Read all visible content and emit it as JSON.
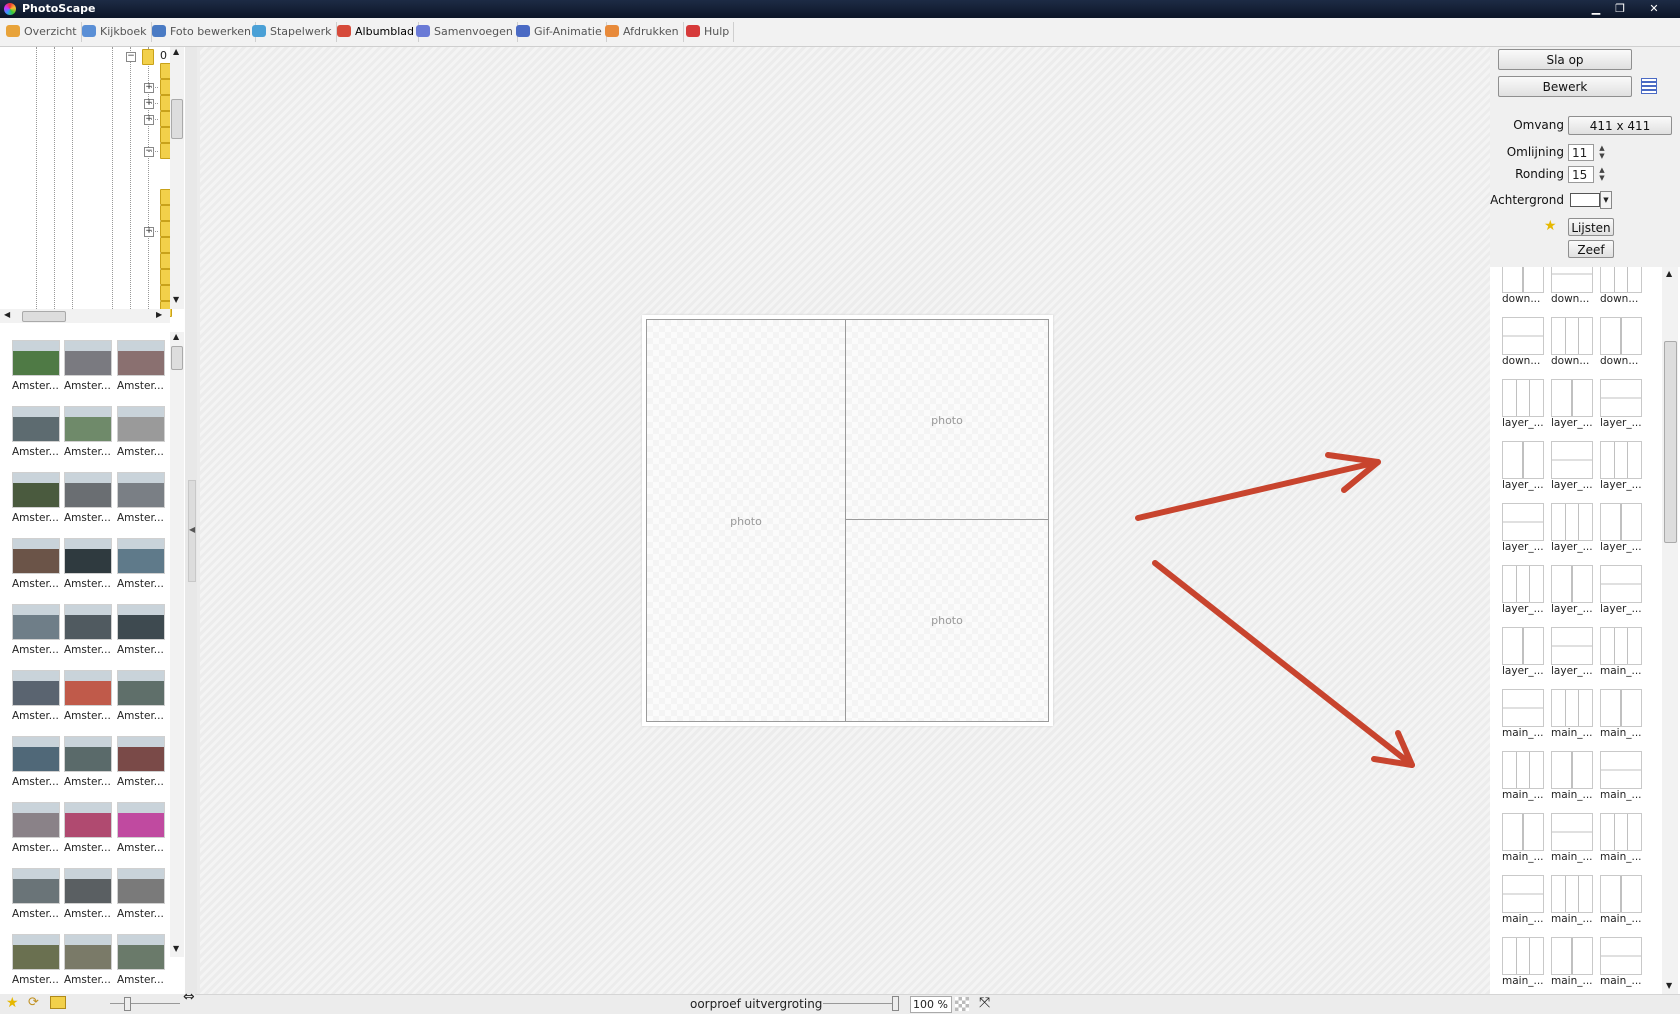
{
  "window": {
    "title": "PhotoScape",
    "controls": [
      "minimize",
      "restore",
      "close"
    ]
  },
  "tabs": [
    {
      "label": "Overzicht",
      "icon": "overview-icon",
      "color": "#e8a33a"
    },
    {
      "label": "Kijkboek",
      "icon": "viewer-icon",
      "color": "#5a8fd6"
    },
    {
      "label": "Foto bewerken",
      "icon": "editor-icon",
      "color": "#4a7bc4"
    },
    {
      "label": "Stapelwerk",
      "icon": "batch-icon",
      "color": "#4aa0d6"
    },
    {
      "label": "Albumblad",
      "icon": "page-icon",
      "color": "#d64a3a",
      "active": true
    },
    {
      "label": "Samenvoegen",
      "icon": "combine-icon",
      "color": "#6a7ad6"
    },
    {
      "label": "Gif-Animatie",
      "icon": "gif-icon",
      "color": "#4a6ac4"
    },
    {
      "label": "Afdrukken",
      "icon": "print-icon",
      "color": "#e88a3a"
    },
    {
      "label": "Hulp",
      "icon": "help-icon",
      "color": "#d63a3a"
    }
  ],
  "tree": {
    "root_label": "0"
  },
  "thumbnails": {
    "labels": [
      "Amster...",
      "Amster...",
      "Amster...",
      "Amster...",
      "Amster...",
      "Amster...",
      "Amster...",
      "Amster...",
      "Amster...",
      "Amster...",
      "Amster...",
      "Amster...",
      "Amster...",
      "Amster...",
      "Amster...",
      "Amster...",
      "Amster...",
      "Amster...",
      "Amster...",
      "Amster...",
      "Amster...",
      "Amster...",
      "Amster...",
      "Amster...",
      "Amster...",
      "Amster...",
      "Amster...",
      "Amster...",
      "Amster...",
      "Amster..."
    ],
    "colors": [
      "#4f7a45",
      "#7a7a80",
      "#8a7070",
      "#5d6b70",
      "#6f8a6a",
      "#9a9a9a",
      "#4a5a3e",
      "#6a6e72",
      "#7a7f85",
      "#6b5448",
      "#2f3a3f",
      "#5f7a8a",
      "#6f7e88",
      "#505a60",
      "#3e4a50",
      "#5a6470",
      "#c05a4a",
      "#5f6f6a",
      "#506878",
      "#5a6a6a",
      "#7a4a48",
      "#8a8288",
      "#b04a70",
      "#c04aa0",
      "#6a7478",
      "#5a5f62",
      "#7a7a7a",
      "#6a7050",
      "#7a7a68",
      "#6a7a6a"
    ]
  },
  "canvas": {
    "slot_label": "photo"
  },
  "right_panel": {
    "save_label": "Sla op",
    "edit_label": "Bewerk",
    "size_label": "Omvang",
    "size_value": "411 x 411",
    "border_label": "Omlijning",
    "border_value": "11",
    "rounding_label": "Ronding",
    "rounding_value": "15",
    "background_label": "Achtergrond",
    "frames_label": "Lijsten",
    "filter_label": "Zeef"
  },
  "templates": {
    "labels": [
      "down...",
      "down...",
      "down...",
      "down...",
      "down...",
      "down...",
      "layer_...",
      "layer_...",
      "layer_...",
      "layer_...",
      "layer_...",
      "layer_...",
      "layer_...",
      "layer_...",
      "layer_...",
      "layer_...",
      "layer_...",
      "layer_...",
      "layer_...",
      "layer_...",
      "main_...",
      "main_...",
      "main_...",
      "main_...",
      "main_...",
      "main_...",
      "main_...",
      "main_...",
      "main_...",
      "main_...",
      "main_...",
      "main_...",
      "main_...",
      "main_...",
      "main_...",
      "main_..."
    ]
  },
  "status": {
    "zoom_mode_label": "oorproef uitvergroting",
    "zoom_value": "100 %"
  },
  "colors": {
    "arrow": "#c8442e",
    "titlebar": "#14203a"
  }
}
